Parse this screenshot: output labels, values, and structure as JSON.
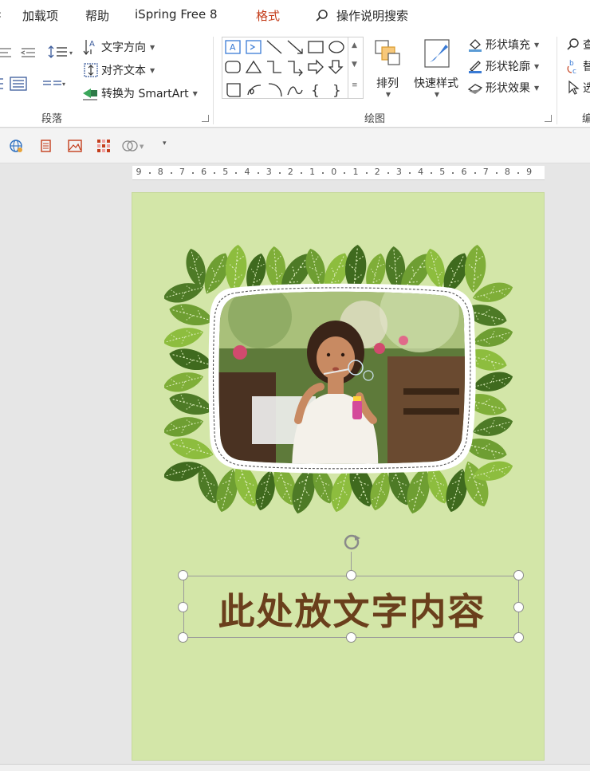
{
  "ribbon_tabs": {
    "addins": "加载项",
    "help": "帮助",
    "ispring": "iSpring Free 8",
    "format": "格式",
    "search_placeholder": "操作说明搜索"
  },
  "paragraph_group": {
    "text_direction": "文字方向",
    "align_text": "对齐文本",
    "convert_smartart": "转换为 SmartArt",
    "label": "段落"
  },
  "drawing_group": {
    "arrange": "排列",
    "quick_styles": "快速样式",
    "shape_fill": "形状填充",
    "shape_outline": "形状轮廓",
    "shape_effects": "形状效果",
    "label": "绘图"
  },
  "editing_group": {
    "find_partial": "查",
    "replace_partial": "替",
    "select_partial": "选",
    "label_partial": "编"
  },
  "ruler": {
    "numbers": [
      "9",
      "8",
      "7",
      "6",
      "5",
      "4",
      "3",
      "2",
      "1",
      "0",
      "1",
      "2",
      "3",
      "4",
      "5",
      "6",
      "7",
      "8",
      "9"
    ]
  },
  "slide": {
    "text": "此处放文字内容",
    "background_color": "#d3e6a8",
    "text_color": "#6a3f1c"
  },
  "colors": {
    "accent": "#c43e1c",
    "leaf_dark": "#4d7a26",
    "leaf_mid": "#6e9e32",
    "leaf_light": "#8dbd3e"
  }
}
